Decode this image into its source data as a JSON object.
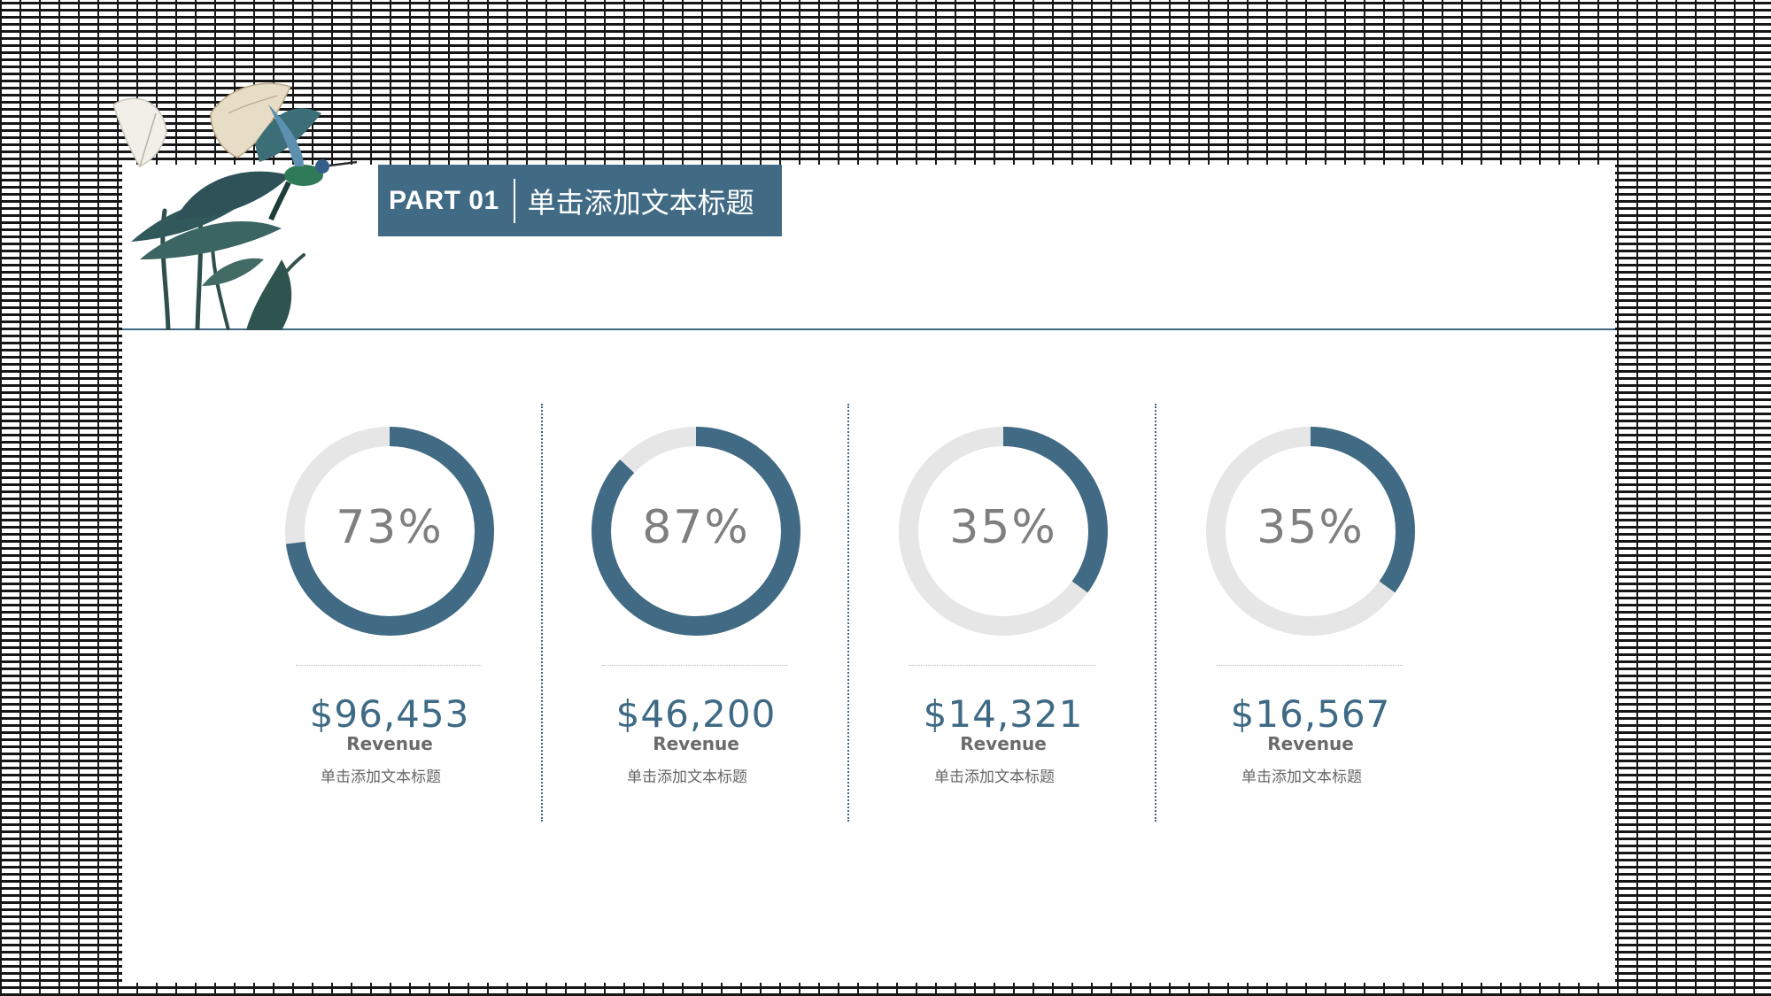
{
  "header": {
    "part_label": "PART 01",
    "title": "单击添加文本标题"
  },
  "chart_data": {
    "type": "donut",
    "series": [
      {
        "percent": 73,
        "percent_label": "73%",
        "value_label": "$96,453",
        "metric_label": "Revenue",
        "caption": "单击添加文本标题"
      },
      {
        "percent": 87,
        "percent_label": "87%",
        "value_label": "$46,200",
        "metric_label": "Revenue",
        "caption": "单击添加文本标题"
      },
      {
        "percent": 35,
        "percent_label": "35%",
        "value_label": "$14,321",
        "metric_label": "Revenue",
        "caption": "单击添加文本标题"
      },
      {
        "percent": 35,
        "percent_label": "35%",
        "value_label": "$16,567",
        "metric_label": "Revenue",
        "caption": "单击添加文本标题"
      }
    ]
  },
  "colors": {
    "accent": "#416b84",
    "ring_track": "#e6e6e6",
    "value_text": "#3e6a85",
    "percent_text": "#7f7f7f"
  },
  "decoration": {
    "illustration": "calla-lily-hummingbird-illustration"
  }
}
